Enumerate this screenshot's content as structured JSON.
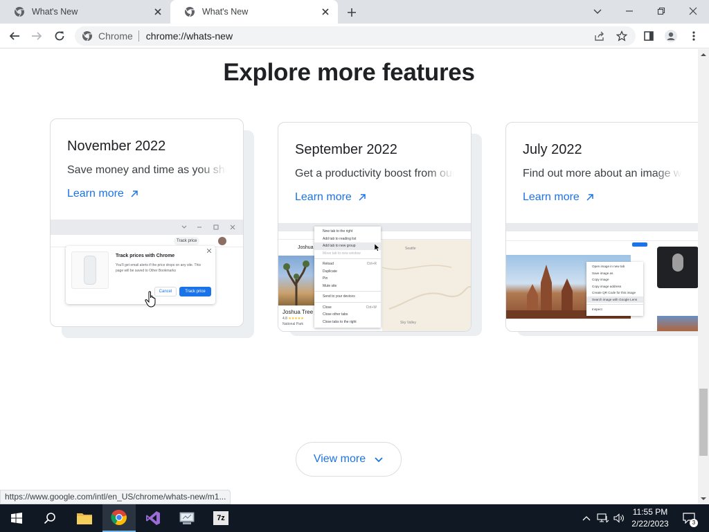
{
  "tabs": [
    {
      "title": "What's New",
      "active": false
    },
    {
      "title": "What's New",
      "active": true
    }
  ],
  "omnibox": {
    "chip": "Chrome",
    "url": "chrome://whats-new"
  },
  "page": {
    "heading": "Explore more features",
    "cards": [
      {
        "title": "November 2022",
        "description": "Save money and time as you shop with Chrome",
        "link": "Learn more",
        "preview": {
          "chip": "Track price",
          "dialog_title": "Track prices with Chrome",
          "dialog_text": "You'll get email alerts if the price drops on any site. This page will be saved to Other Bookmarks",
          "cancel": "Cancel",
          "confirm": "Track price"
        }
      },
      {
        "title": "September 2022",
        "description": "Get a productivity boost from our new features",
        "link": "Learn more",
        "preview": {
          "place_name": "Joshua Tree",
          "place_sub": "National Park",
          "rating": "4.8",
          "map_label_1": "Joshua T",
          "map_label_2": "Seattle",
          "map_label_3": "Sky Valley",
          "menu_items": [
            "New tab to the right",
            "Add tab to reading list",
            "Add tab to new group",
            "Move tab to new window",
            "Reload",
            "Duplicate",
            "Pin",
            "Mute site",
            "Send to your devices",
            "Close",
            "Close other tabs",
            "Close tabs to the right"
          ],
          "menu_shortcuts": [
            "Ctrl+R",
            "Ctrl+W"
          ]
        }
      },
      {
        "title": "July 2022",
        "description": "Find out more about an image with Google Lens",
        "link": "Learn more",
        "preview": {
          "menu_items": [
            "Open image in new tab",
            "Save image as",
            "Copy image",
            "Copy image address",
            "Create QR Code for this image",
            "Search image with Google Lens",
            "Inspect"
          ]
        }
      }
    ],
    "view_more": "View more"
  },
  "status_url": "https://www.google.com/intl/en_US/chrome/whats-new/m1...",
  "taskbar": {
    "time": "11:55 PM",
    "date": "2/22/2023",
    "notifications": "3",
    "apps": [
      "start",
      "search",
      "file-explorer",
      "chrome",
      "visual-studio",
      "disk-utility",
      "7zip"
    ],
    "seven_zip_label": "7z"
  },
  "colors": {
    "accent": "#1a73e8",
    "taskbar": "#101923",
    "tabstrip": "#dee1e6"
  }
}
